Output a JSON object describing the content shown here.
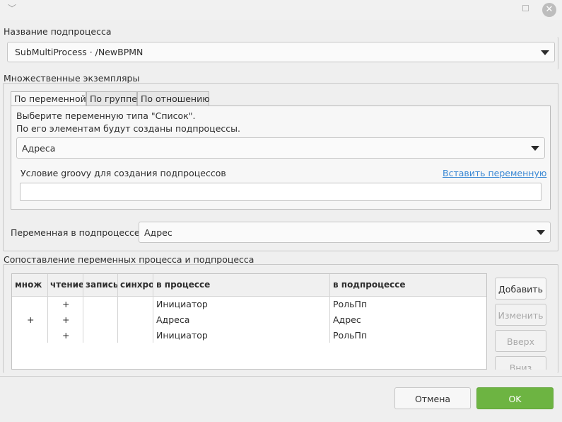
{
  "window": {
    "menu_icon": "chevron-down-icon",
    "maximize_icon": "maximize-icon",
    "close_icon": "close-icon",
    "close_glyph": "✕",
    "chevron_glyph": "﹀"
  },
  "subprocess_name": {
    "legend": "Название подпроцесса",
    "value": "SubMultiProcess  · /NewBPMN"
  },
  "multi_instances": {
    "legend": "Множественные экземпляры",
    "tabs": [
      "По переменной",
      "По группе",
      "По отношению"
    ],
    "active_tab": 0,
    "hint_line1": "Выберите переменную типа \"Список\".",
    "hint_line2": "По его элементам будут созданы подпроцессы.",
    "list_variable": "Адреса",
    "groovy_label": "Условие groovy для создания подпроцессов",
    "insert_variable_link": "Вставить переменную",
    "groovy_value": "",
    "subprocess_variable_label": "Переменная в подпроцессе:",
    "subprocess_variable": "Адрес"
  },
  "mapping": {
    "legend": "Сопоставление переменных процесса и подпроцесса",
    "columns": [
      "множ",
      "чтение",
      "запись",
      "синхро",
      "в процессе",
      "в подпроцессе"
    ],
    "rows": [
      {
        "mult": "",
        "read": "+",
        "write": "",
        "sync": "",
        "in_process": "Инициатор",
        "in_subprocess": "РольПп"
      },
      {
        "mult": "+",
        "read": "+",
        "write": "",
        "sync": "",
        "in_process": "Адреса",
        "in_subprocess": "Адрес"
      },
      {
        "mult": "",
        "read": "+",
        "write": "",
        "sync": "",
        "in_process": "Инициатор",
        "in_subprocess": "РольПп"
      }
    ],
    "buttons": {
      "add": "Добавить",
      "edit": "Изменить",
      "up": "Вверх",
      "down": "Вниз"
    }
  },
  "footer": {
    "cancel": "Отмена",
    "ok": "OK"
  },
  "colors": {
    "ok_button": "#6db442",
    "link": "#3a88d4"
  }
}
